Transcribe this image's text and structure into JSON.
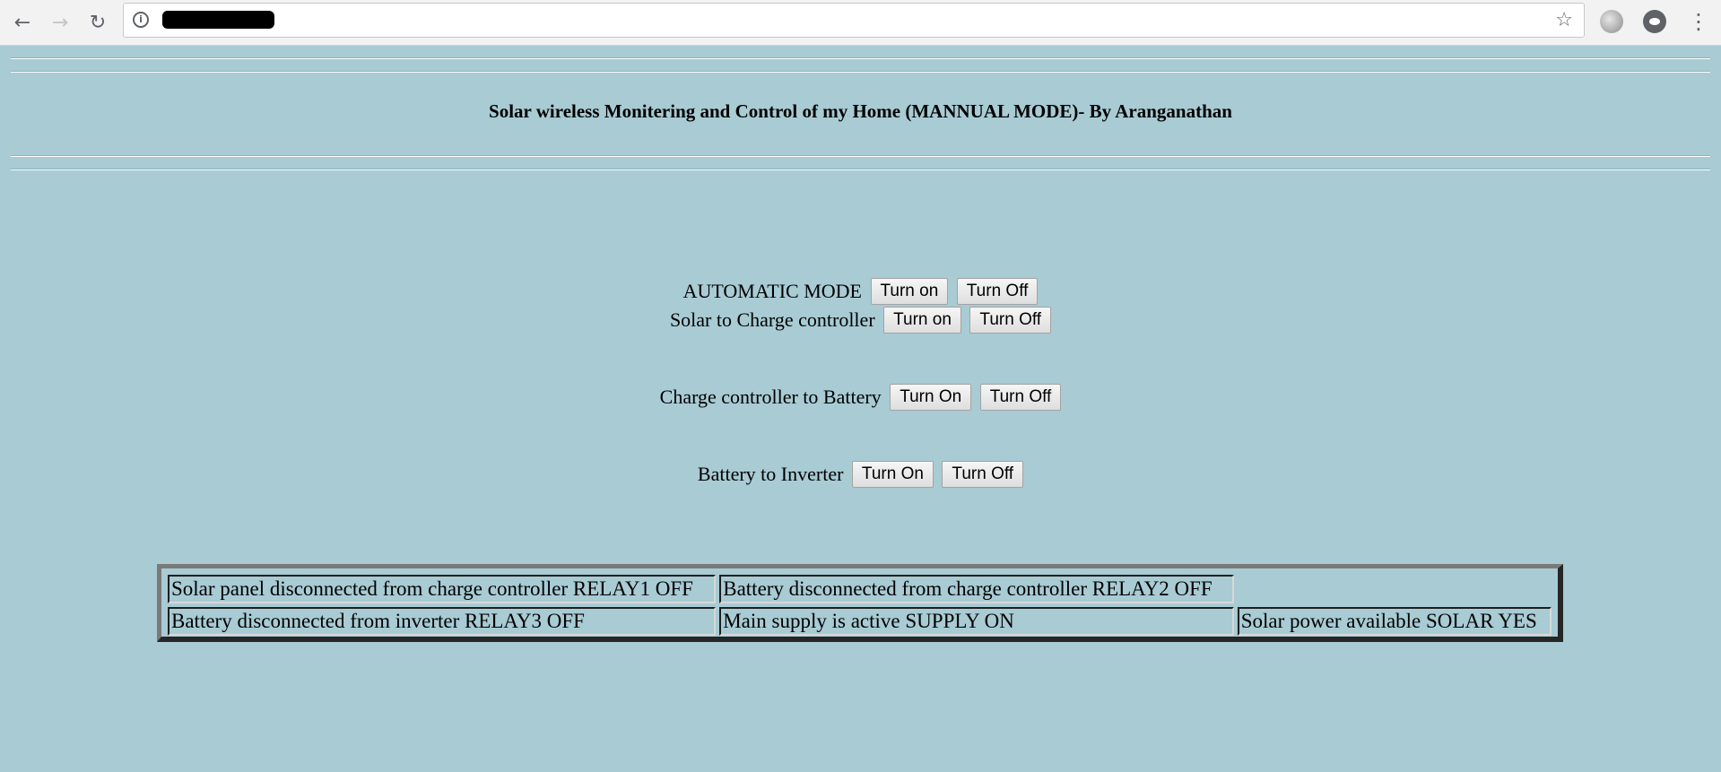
{
  "browser": {
    "back_icon": "arrow-left-icon",
    "forward_icon": "arrow-right-icon",
    "reload_icon": "reload-icon",
    "site_info_icon": "info-icon",
    "bookmark_icon": "star-icon",
    "menu_icon": "kebab-menu-icon",
    "url_text": "██████"
  },
  "page": {
    "title": "Solar wireless Monitering and Control of my Home (MANNUAL MODE)- By Aranganathan",
    "background_color": "#a8cbd4"
  },
  "controls": [
    {
      "label": "AUTOMATIC MODE",
      "on_label": "Turn on",
      "off_label": "Turn Off"
    },
    {
      "label": "Solar to Charge controller",
      "on_label": "Turn on",
      "off_label": "Turn Off"
    },
    {
      "label": "Charge controller to Battery",
      "on_label": "Turn On",
      "off_label": "Turn Off"
    },
    {
      "label": "Battery to Inverter",
      "on_label": "Turn On",
      "off_label": "Turn Off"
    }
  ],
  "status": {
    "rows": [
      [
        "Solar panel disconnected from charge controller RELAY1 OFF",
        "Battery disconnected from charge controller RELAY2 OFF",
        ""
      ],
      [
        "Battery disconnected from inverter RELAY3 OFF",
        "Main supply is active SUPPLY ON",
        "Solar power available SOLAR YES"
      ]
    ]
  }
}
